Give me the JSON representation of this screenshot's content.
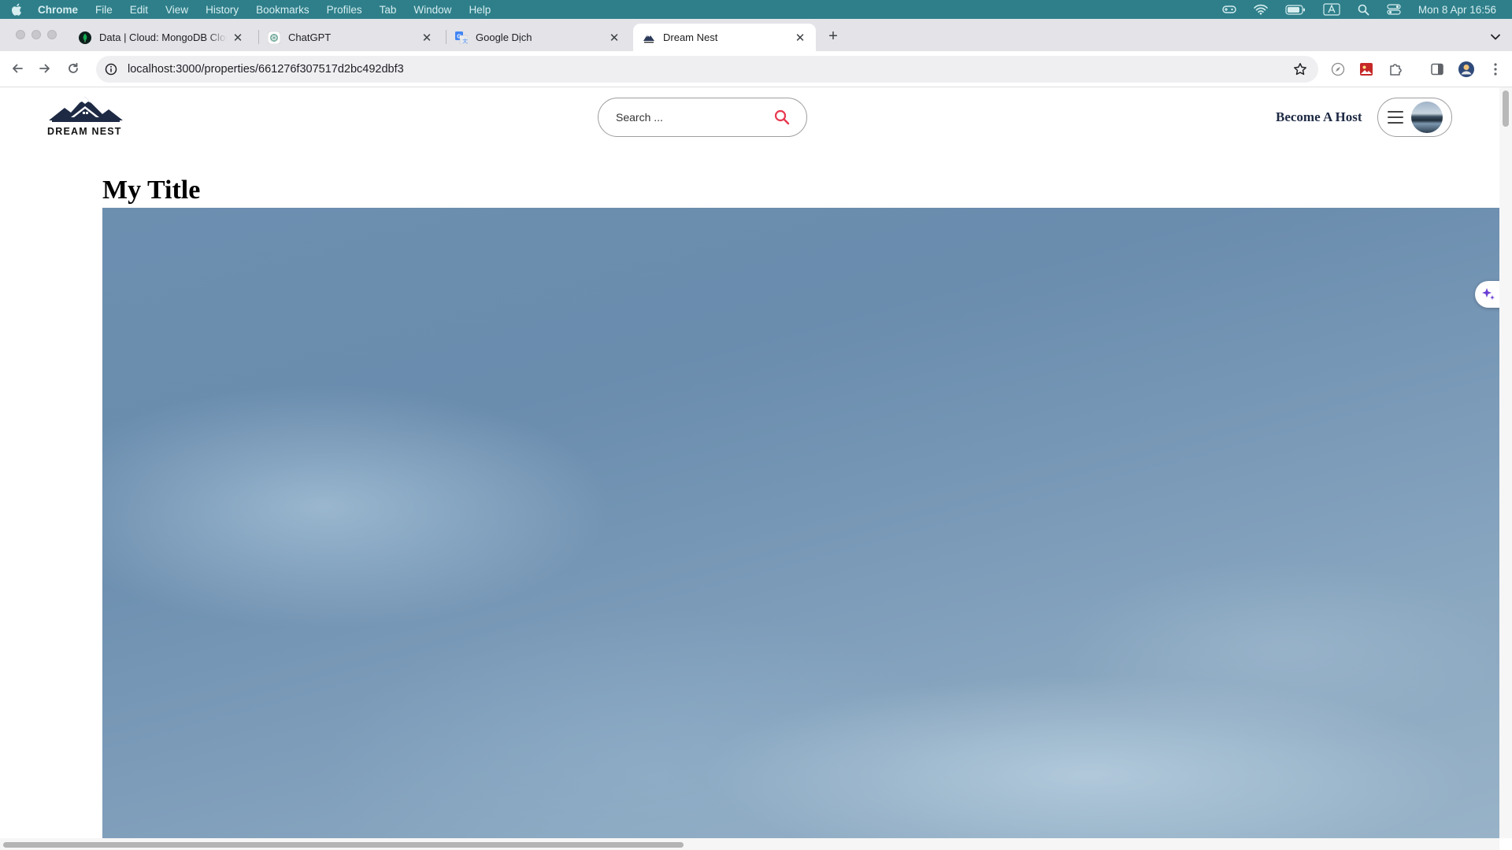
{
  "menubar": {
    "app_name": "Chrome",
    "items": [
      "File",
      "Edit",
      "View",
      "History",
      "Bookmarks",
      "Profiles",
      "Tab",
      "Window",
      "Help"
    ],
    "clock": "Mon 8 Apr  16:56",
    "color": "#2e7f8a"
  },
  "tabs": [
    {
      "label": "Data | Cloud: MongoDB Cloud",
      "icon": "mongodb-leaf-icon",
      "active": false
    },
    {
      "label": "ChatGPT",
      "icon": "chatgpt-icon",
      "active": false
    },
    {
      "label": "Google Dịch",
      "icon": "google-translate-icon",
      "active": false
    },
    {
      "label": "Dream Nest",
      "icon": "dream-nest-favicon",
      "active": true
    }
  ],
  "toolbar": {
    "url": "localhost:3000/properties/661276f307517d2bc492dbf3"
  },
  "site": {
    "logo_text": "DREAM NEST",
    "search_placeholder": "Search ...",
    "become_host_label": "Become A Host",
    "search_icon_color": "#e8384f"
  },
  "listing": {
    "title": "My Title"
  }
}
